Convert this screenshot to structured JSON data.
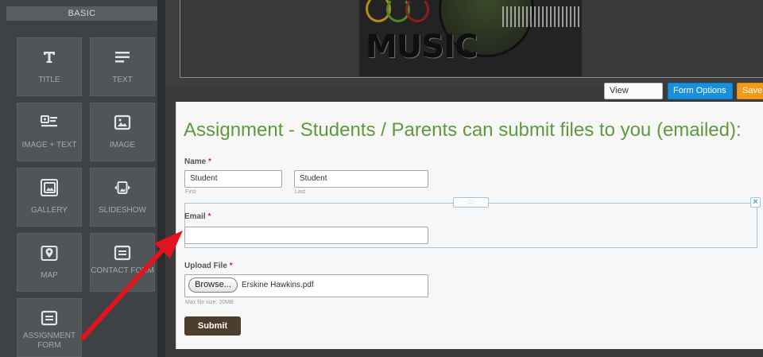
{
  "sidebar": {
    "header": "BASIC",
    "tiles": [
      {
        "label": "TITLE",
        "icon": "title-icon"
      },
      {
        "label": "TEXT",
        "icon": "text-icon"
      },
      {
        "label": "IMAGE + TEXT",
        "icon": "image-text-icon"
      },
      {
        "label": "IMAGE",
        "icon": "image-icon"
      },
      {
        "label": "GALLERY",
        "icon": "gallery-icon"
      },
      {
        "label": "SLIDESHOW",
        "icon": "slideshow-icon"
      },
      {
        "label": "MAP",
        "icon": "map-pin-icon"
      },
      {
        "label": "CONTACT FORM",
        "icon": "form-icon"
      },
      {
        "label": "ASSIGNMENT FORM",
        "icon": "form-icon"
      }
    ]
  },
  "header_image": {
    "text": "MUSIC"
  },
  "toolbar": {
    "view_entries": "View Entries",
    "form_options": "Form Options",
    "save": "Save"
  },
  "form": {
    "title": "Assignment - Students / Parents can submit files to you (emailed):",
    "name_label": "Name",
    "first_value": "Student",
    "first_sublabel": "First",
    "last_value": "Student",
    "last_sublabel": "Last",
    "email_label": "Email",
    "email_value": "",
    "upload_label": "Upload File",
    "browse_label": "Browse...",
    "file_name": "Erskine Hawkins.pdf",
    "max_size": "Max file size: 20MB",
    "submit_label": "Submit",
    "required_mark": "*",
    "drag_handle_label": "::::",
    "delete_label": "×"
  },
  "colors": {
    "title_green": "#5d9a3c",
    "accent_blue": "#1a8fdc",
    "save_orange": "#f39a1a",
    "arrow_red": "#e0141e",
    "submit_brown": "#4d3d2c"
  }
}
